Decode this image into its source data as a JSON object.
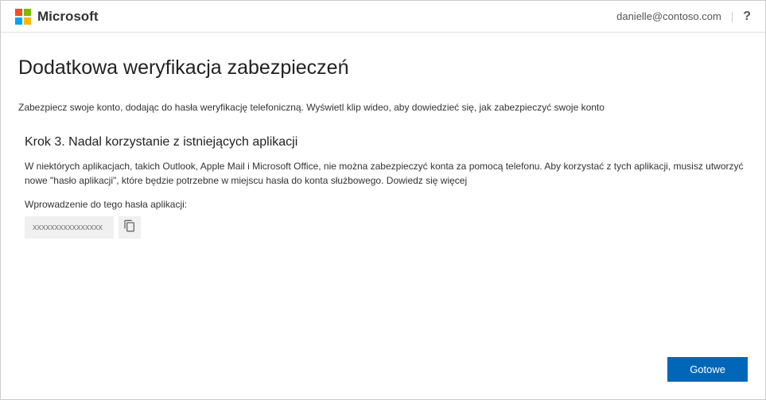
{
  "header": {
    "brand": "Microsoft",
    "user_email": "danielle@contoso.com",
    "help": "?"
  },
  "page": {
    "title": "Dodatkowa weryfikacja zabezpieczeń",
    "intro": "Zabezpiecz swoje konto, dodając do hasła weryfikację telefoniczną. Wyświetl klip wideo, aby dowiedzieć się, jak zabezpieczyć swoje konto"
  },
  "step": {
    "heading": "Krok 3. Nadal korzystanie z istniejących aplikacji",
    "body": "W niektórych aplikacjach, takich Outlook, Apple Mail i Microsoft Office, nie można zabezpieczyć konta za pomocą telefonu. Aby korzystać z tych aplikacji, musisz utworzyć nowe \"hasło aplikacji\", które będzie potrzebne w miejscu hasła do konta służbowego. Dowiedz się więcej",
    "password_label": "Wprowadzenie do tego hasła aplikacji:",
    "password_value": "xxxxxxxxxxxxxxxx"
  },
  "buttons": {
    "done": "Gotowe"
  }
}
